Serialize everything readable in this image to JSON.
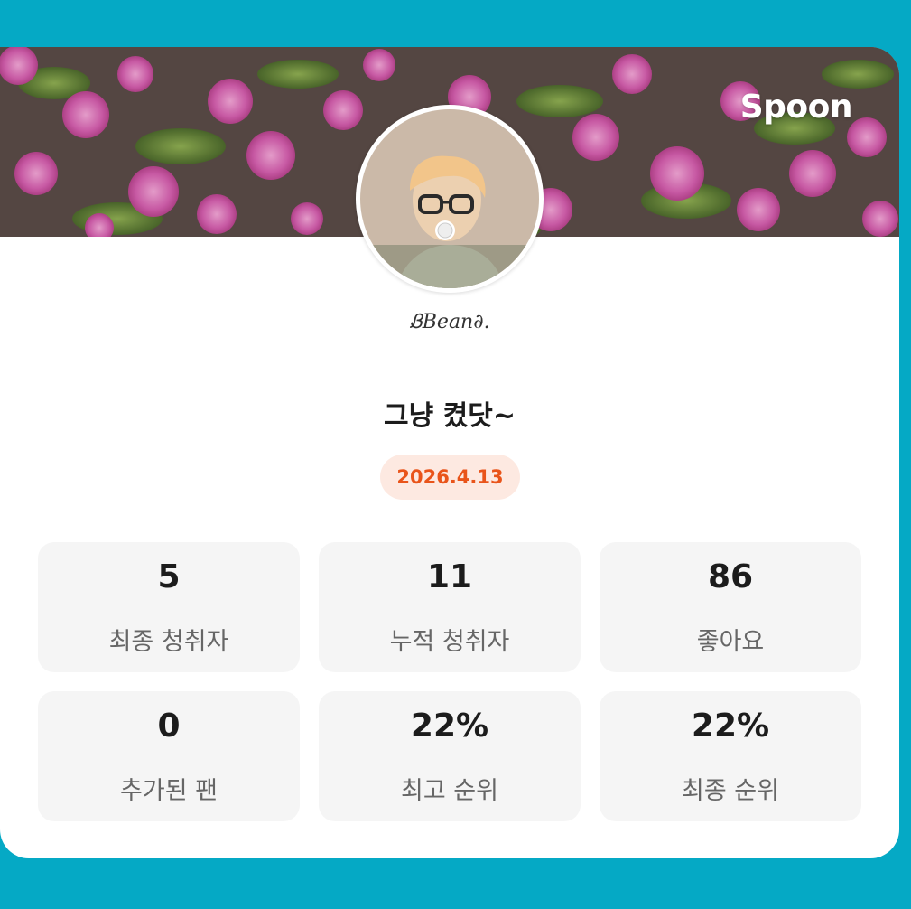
{
  "header": {
    "brand": "Spoon"
  },
  "profile": {
    "nickname": "ᏰBean∂."
  },
  "broadcast": {
    "title": "그냥 켰닷~",
    "date": "2026.4.13"
  },
  "stats": [
    {
      "value": "5",
      "label": "최종 청취자"
    },
    {
      "value": "11",
      "label": "누적 청취자"
    },
    {
      "value": "86",
      "label": "좋아요"
    },
    {
      "value": "0",
      "label": "추가된 팬"
    },
    {
      "value": "22%",
      "label": "최고 순위"
    },
    {
      "value": "22%",
      "label": "최종 순위"
    }
  ],
  "colors": {
    "background": "#05a9c5",
    "card": "#ffffff",
    "accent": "#e9541a",
    "badge_bg": "#fde9e1",
    "tile_bg": "#f5f5f5"
  }
}
